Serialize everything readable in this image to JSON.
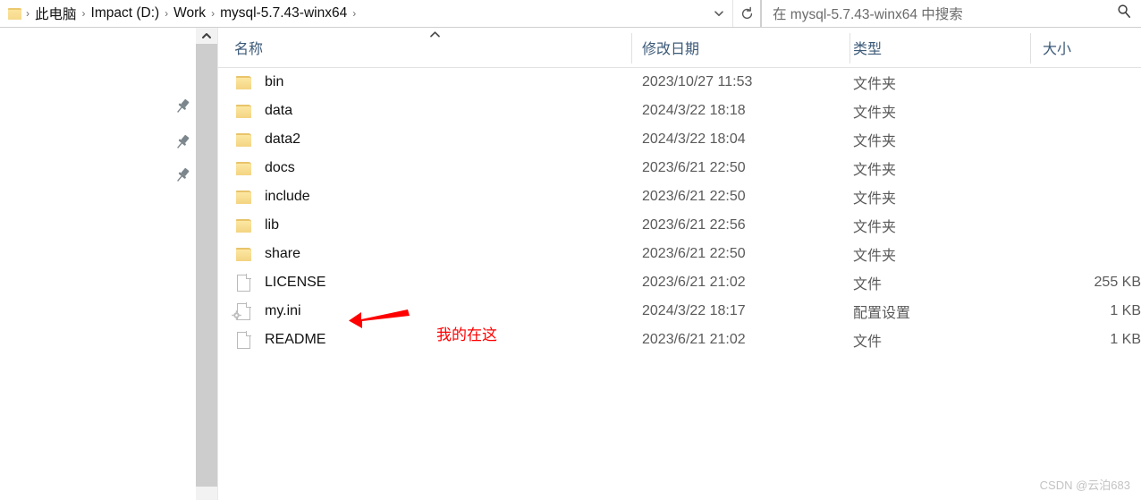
{
  "window": {
    "type": "windows-file-explorer"
  },
  "address_bar": {
    "folder_icon": "folder-icon",
    "separator": "›",
    "crumbs": [
      {
        "label": "此电脑"
      },
      {
        "label": "Impact (D:)"
      },
      {
        "label": "Work"
      },
      {
        "label": "mysql-5.7.43-winx64"
      }
    ],
    "dropdown_icon": "chevron-down-icon",
    "refresh_icon": "refresh-icon"
  },
  "search": {
    "placeholder": "在 mysql-5.7.43-winx64 中搜索",
    "value": "",
    "icon": "search-icon"
  },
  "nav_pane": {
    "scroll_up_icon": "chevron-up-icon",
    "pins": [
      {
        "icon": "pin-icon"
      },
      {
        "icon": "pin-icon"
      },
      {
        "icon": "pin-icon"
      }
    ]
  },
  "file_list": {
    "columns": [
      {
        "key": "name",
        "label": "名称",
        "sorted": true,
        "sort_indicator": "▲"
      },
      {
        "key": "date",
        "label": "修改日期"
      },
      {
        "key": "type",
        "label": "类型"
      },
      {
        "key": "size",
        "label": "大小"
      }
    ],
    "rows": [
      {
        "icon": "folder-icon",
        "name": "bin",
        "date": "2023/10/27 11:53",
        "type": "文件夹",
        "size": ""
      },
      {
        "icon": "folder-icon",
        "name": "data",
        "date": "2024/3/22 18:18",
        "type": "文件夹",
        "size": ""
      },
      {
        "icon": "folder-icon",
        "name": "data2",
        "date": "2024/3/22 18:04",
        "type": "文件夹",
        "size": ""
      },
      {
        "icon": "folder-icon",
        "name": "docs",
        "date": "2023/6/21 22:50",
        "type": "文件夹",
        "size": ""
      },
      {
        "icon": "folder-icon",
        "name": "include",
        "date": "2023/6/21 22:50",
        "type": "文件夹",
        "size": ""
      },
      {
        "icon": "folder-icon",
        "name": "lib",
        "date": "2023/6/21 22:56",
        "type": "文件夹",
        "size": ""
      },
      {
        "icon": "folder-icon",
        "name": "share",
        "date": "2023/6/21 22:50",
        "type": "文件夹",
        "size": ""
      },
      {
        "icon": "document-icon",
        "name": "LICENSE",
        "date": "2023/6/21 21:02",
        "type": "文件",
        "size": "255 KB"
      },
      {
        "icon": "config-file-icon",
        "name": "my.ini",
        "date": "2024/3/22 18:17",
        "type": "配置设置",
        "size": "1 KB"
      },
      {
        "icon": "document-icon",
        "name": "README",
        "date": "2023/6/21 21:02",
        "type": "文件",
        "size": "1 KB"
      }
    ]
  },
  "annotation": {
    "arrow_icon": "red-arrow-left-icon",
    "text": "我的在这",
    "color": "#ff0000"
  },
  "watermark": {
    "text": "CSDN @云泊683"
  }
}
